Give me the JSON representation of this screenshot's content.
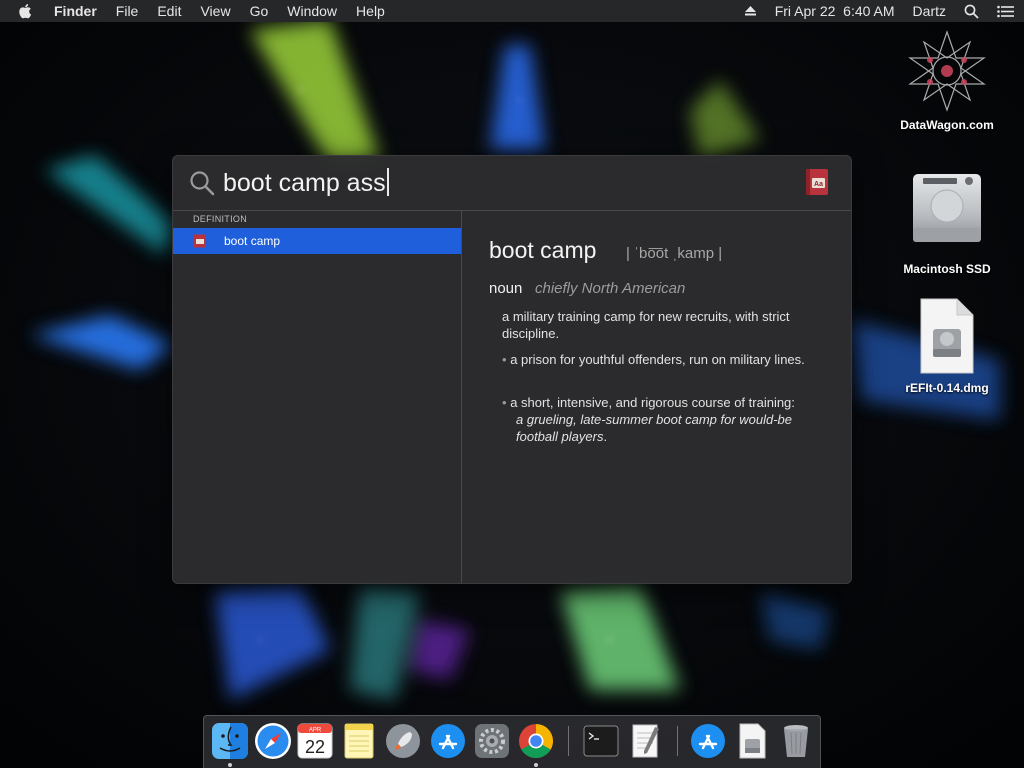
{
  "menubar": {
    "apple_icon": "apple-logo-icon",
    "app_name": "Finder",
    "menus": [
      "File",
      "Edit",
      "View",
      "Go",
      "Window",
      "Help"
    ],
    "clock": "Fri Apr 22  6:40 AM",
    "user": "Dartz"
  },
  "desktop": {
    "icons": [
      {
        "label": "DataWagon.com",
        "icon": "star-emblem-icon"
      },
      {
        "label": "Macintosh SSD",
        "icon": "hard-drive-icon"
      },
      {
        "label": "rEFIt-0.14.dmg",
        "icon": "disk-image-icon"
      }
    ]
  },
  "spotlight": {
    "query": "boot camp ass",
    "section_title": "DEFINITION",
    "results": [
      {
        "label": "boot camp",
        "icon": "dictionary-icon",
        "selected": true
      }
    ],
    "preview": {
      "headword": "boot camp",
      "pronunciation": "| ˈbo͞ot ˌkamp |",
      "part_of_speech": "noun",
      "register": "chiefly North American",
      "definitions": [
        {
          "text": "a military training camp for new recruits, with strict discipline."
        },
        {
          "bullet": "•",
          "text": "a prison for youthful offenders, run on military lines."
        },
        {
          "bullet": "•",
          "text": "a short, intensive, and rigorous course of training:",
          "example": "a grueling, late-summer boot camp for would-be football players",
          "example_end": "."
        }
      ]
    }
  },
  "dock": {
    "calendar_month": "APR",
    "calendar_day": "22",
    "apps": [
      "Finder",
      "Safari",
      "Calendar",
      "Notes",
      "Launchpad",
      "App Store",
      "System Preferences",
      "Google Chrome",
      "Terminal",
      "TextEdit",
      "App Store Downloads",
      "Disk Image",
      "Trash"
    ]
  },
  "colors": {
    "selection": "#1f5fdc",
    "panel": "#2c2c2e",
    "menubar": "#262729"
  }
}
